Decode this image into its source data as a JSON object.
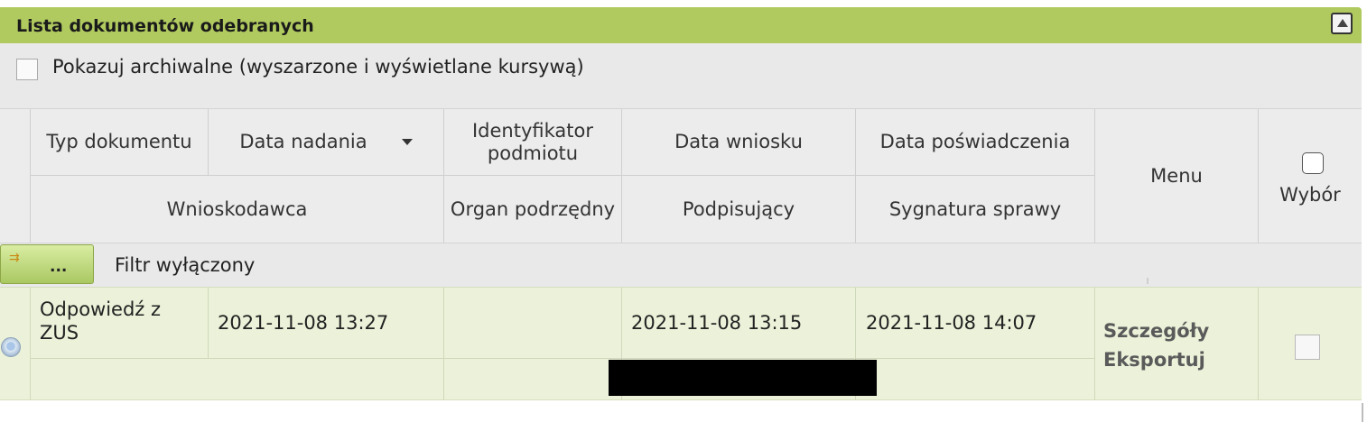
{
  "panel": {
    "title": "Lista dokumentów odebranych",
    "collapse_icon": "collapse-up-icon"
  },
  "archive_toggle": {
    "label": "Pokazuj archiwalne (wyszarzone i wyświetlane kursywą)",
    "checked": false
  },
  "table": {
    "headers": {
      "typ": "Typ dokumentu",
      "data_nadania": "Data nadania",
      "identyfikator": "Identyfikator podmiotu",
      "data_wniosku": "Data wniosku",
      "data_poswiadczenia": "Data poświadczenia",
      "menu": "Menu",
      "wybor": "Wybór",
      "wnioskodawca": "Wnioskodawca",
      "organ": "Organ podrzędny",
      "podpisujacy": "Podpisujący",
      "sygnatura": "Sygnatura sprawy"
    },
    "sort_icon": "sort-down-icon",
    "filter": {
      "button_label": "...",
      "button_icon": "filter-arrows-icon",
      "status": "Filtr wyłączony"
    },
    "rows": [
      {
        "typ": "Odpowiedź z ZUS",
        "data_nadania": "2021-11-08 13:27",
        "identyfikator": "",
        "data_wniosku": "2021-11-08 13:15",
        "data_poswiadczenia": "2021-11-08 14:07",
        "menu_details": "Szczegóły",
        "menu_export": "Eksportuj",
        "selected": false
      }
    ]
  },
  "colors": {
    "title_bar": "#b0ca5f",
    "row_background": "#ebf2d9",
    "header_background": "#ececec"
  }
}
